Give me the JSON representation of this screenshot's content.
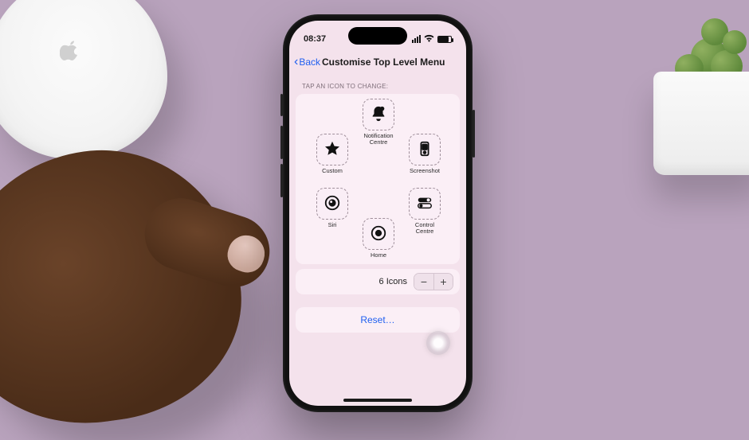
{
  "statusbar": {
    "time": "08:37"
  },
  "nav": {
    "back": "Back",
    "title": "Customise Top Level Menu"
  },
  "section_header": "TAP AN ICON TO CHANGE:",
  "icons": {
    "top": {
      "label": "Notification Centre"
    },
    "tr": {
      "label": "Screenshot"
    },
    "br": {
      "label": "Control Centre"
    },
    "bottom": {
      "label": "Home"
    },
    "bl": {
      "label": "Siri"
    },
    "tl": {
      "label": "Custom"
    }
  },
  "count_row": {
    "label": "6 Icons",
    "minus": "−",
    "plus": "+"
  },
  "reset": {
    "label": "Reset…"
  }
}
